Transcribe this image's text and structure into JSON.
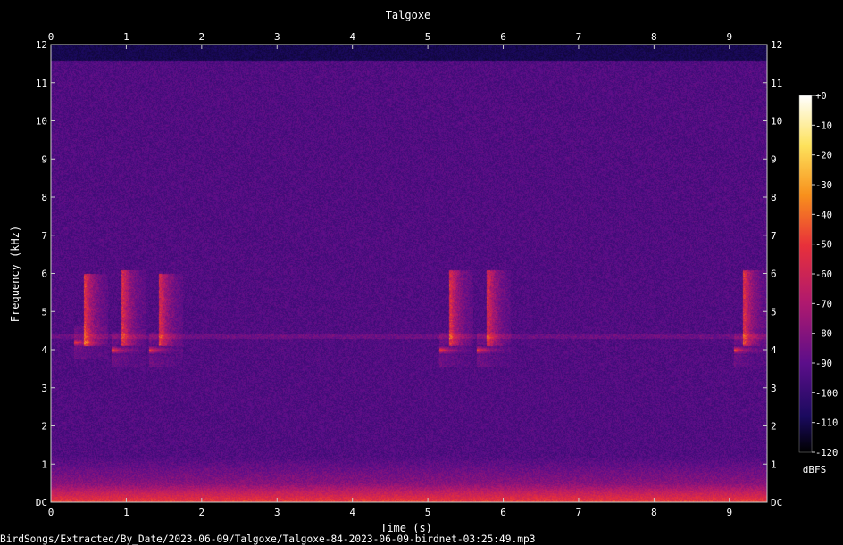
{
  "chart_data": {
    "type": "heatmap",
    "title": "Talgoxe",
    "xlabel": "Time (s)",
    "ylabel": "Frequency (kHz)",
    "xlim": [
      0,
      9.5
    ],
    "ylim": [
      0,
      12
    ],
    "x_ticks": [
      "0",
      "1",
      "2",
      "3",
      "4",
      "5",
      "6",
      "7",
      "8",
      "9"
    ],
    "y_ticks": [
      "DC",
      "1",
      "2",
      "3",
      "4",
      "5",
      "6",
      "7",
      "8",
      "9",
      "10",
      "11",
      "12"
    ],
    "colorbar": {
      "label": "dBFS",
      "ticks": [
        "+0",
        "-10",
        "-20",
        "-30",
        "-40",
        "-50",
        "-60",
        "-70",
        "-80",
        "-90",
        "-100",
        "-110",
        "-120"
      ],
      "range": [
        -120,
        0
      ],
      "colors": [
        "#000000",
        "#1a0a5e",
        "#5c0e8a",
        "#b0196e",
        "#e8303a",
        "#f8901c",
        "#fde25c",
        "#ffffff"
      ]
    },
    "noise_ceiling_khz": 11.6,
    "calls": [
      {
        "t": 0.45,
        "f_low": 4.1,
        "f_high": 6.0,
        "tone_khz": 4.2,
        "strength": 0.9
      },
      {
        "t": 0.95,
        "f_low": 4.1,
        "f_high": 6.1,
        "tone_khz": 4.0,
        "strength": 0.85
      },
      {
        "t": 1.45,
        "f_low": 4.1,
        "f_high": 6.0,
        "tone_khz": 4.0,
        "strength": 0.8
      },
      {
        "t": 5.3,
        "f_low": 4.1,
        "f_high": 6.1,
        "tone_khz": 4.0,
        "strength": 0.85
      },
      {
        "t": 5.8,
        "f_low": 4.1,
        "f_high": 6.1,
        "tone_khz": 4.0,
        "strength": 0.8
      },
      {
        "t": 9.2,
        "f_low": 4.1,
        "f_high": 6.1,
        "tone_khz": 4.0,
        "strength": 0.85
      }
    ]
  },
  "filepath": "BirdSongs/Extracted/By_Date/2023-06-09/Talgoxe/Talgoxe-84-2023-06-09-birdnet-03:25:49.mp3"
}
